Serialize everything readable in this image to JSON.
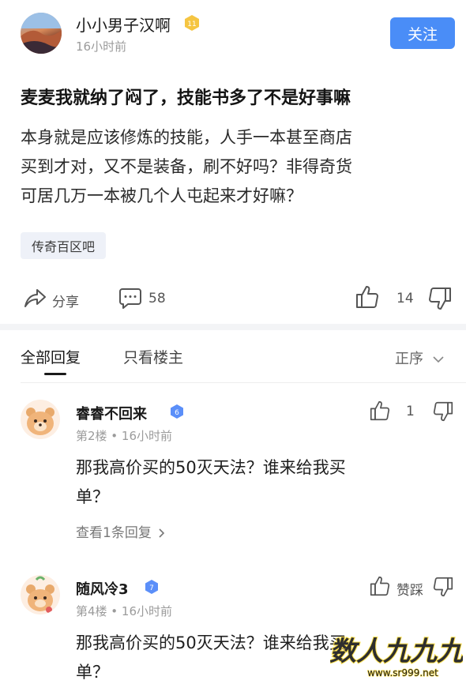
{
  "author": {
    "name": "小小男子汉啊",
    "level": "11",
    "time": "16小时前",
    "follow_label": "关注"
  },
  "post": {
    "title": "麦麦我就纳了闷了，技能书多了不是好事嘛",
    "body_lines": [
      "本身就是应该修炼的技能，人手一本甚至商店",
      "买到才对，又不是装备，刷不好吗？非得奇货",
      "可居几万一本被几个人屯起来才好嘛？"
    ],
    "forum_tag": "传奇百区吧"
  },
  "actions": {
    "share_label": "分享",
    "comment_count": "58",
    "like_count": "14"
  },
  "tabs": {
    "all_replies": "全部回复",
    "op_only": "只看楼主",
    "sort_label": "正序"
  },
  "replies": [
    {
      "name": "睿睿不回来",
      "level": "6",
      "meta": "第2楼 • 16小时前",
      "like_count": "1",
      "text_lines": [
        "那我高价买的50灭天法？谁来给我买",
        "单？"
      ],
      "view_replies": "查看1条回复"
    },
    {
      "name": "随风冷3",
      "level": "7",
      "meta": "第4楼 • 16小时前",
      "like_label": "赞踩",
      "text_lines": [
        "那我高价买的50灭天法？谁来给我买",
        "单？"
      ]
    }
  ],
  "watermark": {
    "main": "数人九九九",
    "url": "www.sr999.net"
  },
  "colors": {
    "accent": "#4a8df7",
    "badge_gold": "#f5c542",
    "badge_blue": "#5b8ff9",
    "muted": "#9b9b9b"
  }
}
